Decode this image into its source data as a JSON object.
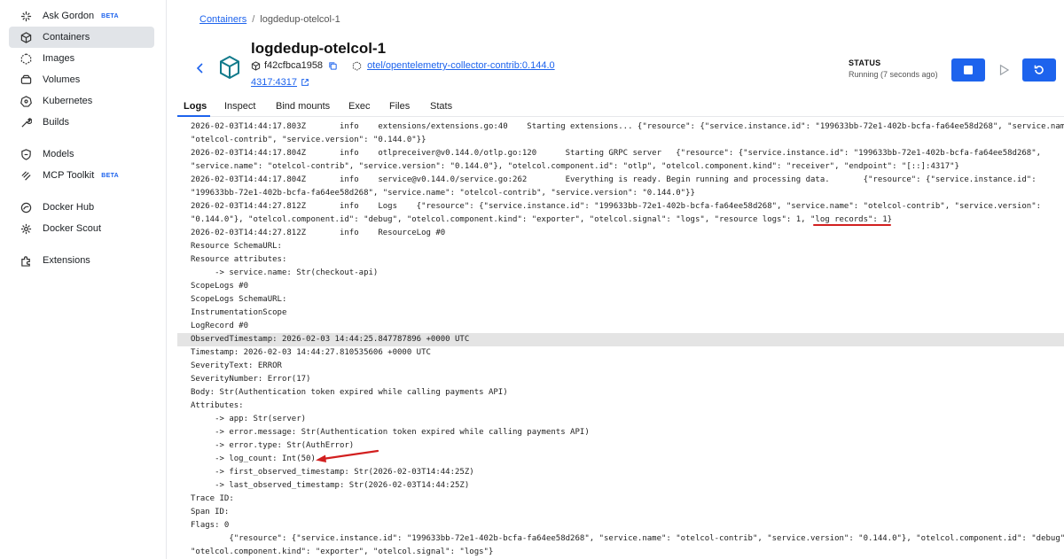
{
  "sidebar": {
    "items": [
      {
        "label": "Ask Gordon",
        "badge": "BETA",
        "icon": "gordon-icon"
      },
      {
        "label": "Containers",
        "icon": "container-icon",
        "active": true
      },
      {
        "label": "Images",
        "icon": "images-icon"
      },
      {
        "label": "Volumes",
        "icon": "volumes-icon"
      },
      {
        "label": "Kubernetes",
        "icon": "kubernetes-icon"
      },
      {
        "label": "Builds",
        "icon": "builds-icon"
      },
      {
        "label": "Models",
        "icon": "models-icon"
      },
      {
        "label": "MCP Toolkit",
        "badge": "BETA",
        "icon": "mcp-icon"
      },
      {
        "label": "Docker Hub",
        "icon": "hub-icon"
      },
      {
        "label": "Docker Scout",
        "icon": "scout-icon"
      },
      {
        "label": "Extensions",
        "icon": "extensions-icon"
      }
    ]
  },
  "breadcrumb": {
    "root": "Containers",
    "current": "logdedup-otelcol-1"
  },
  "container": {
    "name": "logdedup-otelcol-1",
    "id": "f42cfbca1958",
    "image": "otel/opentelemetry-collector-contrib:0.144.0",
    "port": "4317:4317"
  },
  "status": {
    "label": "STATUS",
    "value": "Running (7 seconds ago)"
  },
  "tabs": [
    "Logs",
    "Inspect",
    "Bind mounts",
    "Exec",
    "Files",
    "Stats"
  ],
  "colors": {
    "accent": "#1d63ed",
    "annotation": "#d21f1f",
    "highlight_row": "#e4e4e4"
  },
  "log_lines": [
    "2026-02-03T14:44:17.803Z       info    extensions/extensions.go:40    Starting extensions... {\"resource\": {\"service.instance.id\": \"199633bb-72e1-402b-bcfa-fa64ee58d268\", \"service.name",
    "\"otelcol-contrib\", \"service.version\": \"0.144.0\"}}",
    "2026-02-03T14:44:17.804Z       info    otlpreceiver@v0.144.0/otlp.go:120      Starting GRPC server   {\"resource\": {\"service.instance.id\": \"199633bb-72e1-402b-bcfa-fa64ee58d268\",",
    "\"service.name\": \"otelcol-contrib\", \"service.version\": \"0.144.0\"}, \"otelcol.component.id\": \"otlp\", \"otelcol.component.kind\": \"receiver\", \"endpoint\": \"[::]:4317\"}",
    "2026-02-03T14:44:17.804Z       info    service@v0.144.0/service.go:262        Everything is ready. Begin running and processing data.       {\"resource\": {\"service.instance.id\":",
    "\"199633bb-72e1-402b-bcfa-fa64ee58d268\", \"service.name\": \"otelcol-contrib\", \"service.version\": \"0.144.0\"}}",
    "2026-02-03T14:44:27.812Z       info    Logs    {\"resource\": {\"service.instance.id\": \"199633bb-72e1-402b-bcfa-fa64ee58d268\", \"service.name\": \"otelcol-contrib\", \"service.version\":",
    "\"0.144.0\"}, \"otelcol.component.id\": \"debug\", \"otelcol.component.kind\": \"exporter\", \"otelcol.signal\": \"logs\", \"resource logs\": 1, \"log records\": 1}",
    "2026-02-03T14:44:27.812Z       info    ResourceLog #0",
    "Resource SchemaURL:",
    "Resource attributes:",
    "     -> service.name: Str(checkout-api)",
    "ScopeLogs #0",
    "ScopeLogs SchemaURL:",
    "InstrumentationScope",
    "LogRecord #0",
    "ObservedTimestamp: 2026-02-03 14:44:25.847787896 +0000 UTC",
    "Timestamp: 2026-02-03 14:44:27.810535606 +0000 UTC",
    "SeverityText: ERROR",
    "SeverityNumber: Error(17)",
    "Body: Str(Authentication token expired while calling payments API)",
    "Attributes:",
    "     -> app: Str(server)",
    "     -> error.message: Str(Authentication token expired while calling payments API)",
    "     -> error.type: Str(AuthError)",
    "     -> log_count: Int(50)",
    "     -> first_observed_timestamp: Str(2026-02-03T14:44:25Z)",
    "     -> last_observed_timestamp: Str(2026-02-03T14:44:25Z)",
    "Trace ID:",
    "Span ID:",
    "Flags: 0",
    "        {\"resource\": {\"service.instance.id\": \"199633bb-72e1-402b-bcfa-fa64ee58d268\", \"service.name\": \"otelcol-contrib\", \"service.version\": \"0.144.0\"}, \"otelcol.component.id\": \"debug\",",
    "\"otelcol.component.kind\": \"exporter\", \"otelcol.signal\": \"logs\"}"
  ]
}
